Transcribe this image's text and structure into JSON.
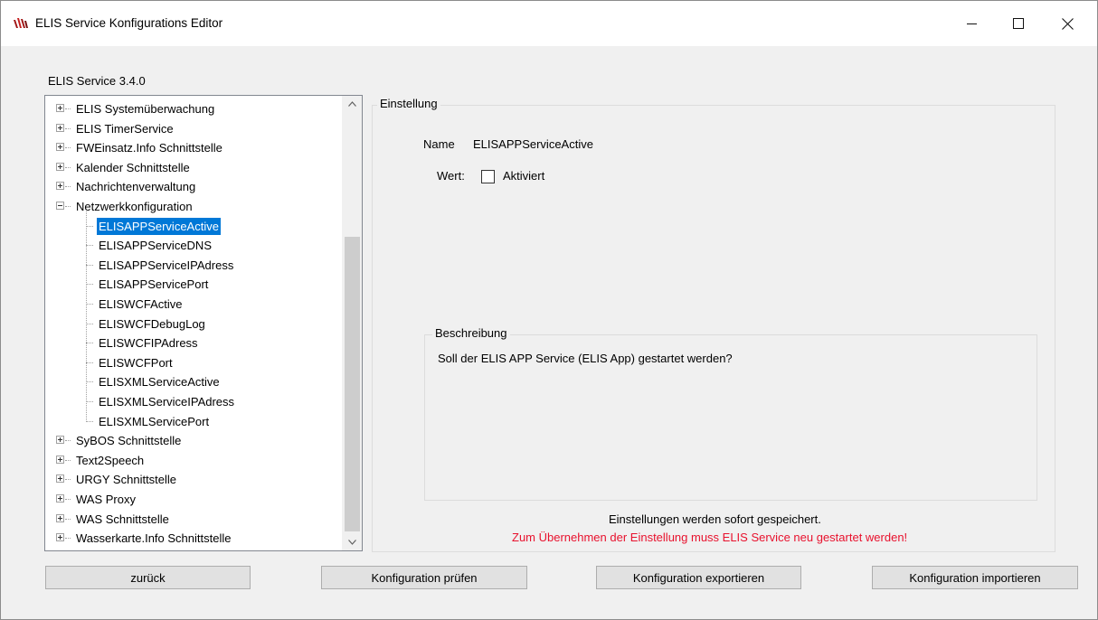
{
  "window": {
    "title": "ELIS Service Konfigurations Editor",
    "icon": "elis-flame-icon",
    "controls": {
      "minimize": "minimize",
      "maximize": "maximize",
      "close": "close"
    }
  },
  "version_label": "ELIS Service 3.4.0",
  "tree": {
    "items": [
      {
        "label": "ELIS Systemüberwachung",
        "expandable": true,
        "expanded": false,
        "level": 0
      },
      {
        "label": "ELIS TimerService",
        "expandable": true,
        "expanded": false,
        "level": 0
      },
      {
        "label": "FWEinsatz.Info Schnittstelle",
        "expandable": true,
        "expanded": false,
        "level": 0
      },
      {
        "label": "Kalender Schnittstelle",
        "expandable": true,
        "expanded": false,
        "level": 0
      },
      {
        "label": "Nachrichtenverwaltung",
        "expandable": true,
        "expanded": false,
        "level": 0
      },
      {
        "label": "Netzwerkkonfiguration",
        "expandable": true,
        "expanded": true,
        "level": 0
      },
      {
        "label": "ELISAPPServiceActive",
        "expandable": false,
        "level": 1,
        "selected": true
      },
      {
        "label": "ELISAPPServiceDNS",
        "expandable": false,
        "level": 1
      },
      {
        "label": "ELISAPPServiceIPAdress",
        "expandable": false,
        "level": 1
      },
      {
        "label": "ELISAPPServicePort",
        "expandable": false,
        "level": 1
      },
      {
        "label": "ELISWCFActive",
        "expandable": false,
        "level": 1
      },
      {
        "label": "ELISWCFDebugLog",
        "expandable": false,
        "level": 1
      },
      {
        "label": "ELISWCFIPAdress",
        "expandable": false,
        "level": 1
      },
      {
        "label": "ELISWCFPort",
        "expandable": false,
        "level": 1
      },
      {
        "label": "ELISXMLServiceActive",
        "expandable": false,
        "level": 1
      },
      {
        "label": "ELISXMLServiceIPAdress",
        "expandable": false,
        "level": 1
      },
      {
        "label": "ELISXMLServicePort",
        "expandable": false,
        "level": 1
      },
      {
        "label": "SyBOS Schnittstelle",
        "expandable": true,
        "expanded": false,
        "level": 0
      },
      {
        "label": "Text2Speech",
        "expandable": true,
        "expanded": false,
        "level": 0
      },
      {
        "label": "URGY Schnittstelle",
        "expandable": true,
        "expanded": false,
        "level": 0
      },
      {
        "label": "WAS Proxy",
        "expandable": true,
        "expanded": false,
        "level": 0
      },
      {
        "label": "WAS Schnittstelle",
        "expandable": true,
        "expanded": false,
        "level": 0
      },
      {
        "label": "Wasserkarte.Info Schnittstelle",
        "expandable": true,
        "expanded": false,
        "level": 0
      }
    ]
  },
  "settings": {
    "group_title": "Einstellung",
    "name_label": "Name",
    "name_value": "ELISAPPServiceActive",
    "value_label": "Wert:",
    "checkbox_label": "Aktiviert",
    "checkbox_checked": false,
    "description_title": "Beschreibung",
    "description_text": "Soll der ELIS APP Service (ELIS App) gestartet werden?",
    "saved_note": "Einstellungen werden sofort gespeichert.",
    "restart_note": "Zum Übernehmen der Einstellung muss ELIS Service neu gestartet werden!",
    "restart_color": "#e8112d"
  },
  "buttons": {
    "back": "zurück",
    "check": "Konfiguration prüfen",
    "export": "Konfiguration exportieren",
    "import": "Konfiguration importieren"
  },
  "colors": {
    "selection": "#0078d7",
    "background": "#f0f0f0"
  }
}
